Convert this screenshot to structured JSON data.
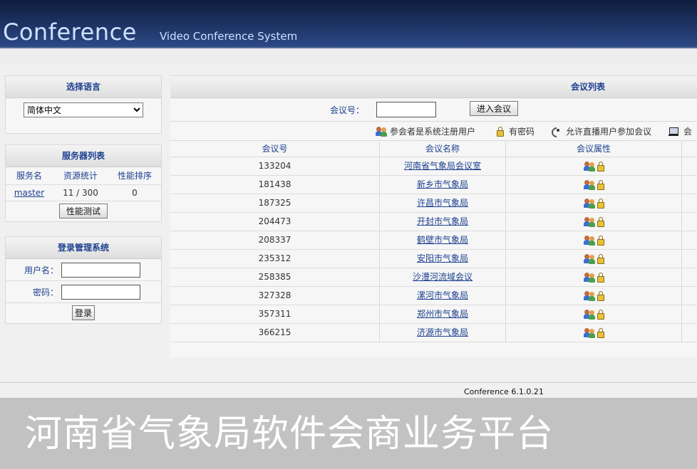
{
  "header": {
    "brand": "Conference",
    "subtitle": "Video Conference System"
  },
  "language_panel": {
    "title": "选择语言",
    "selected": "简体中文"
  },
  "server_panel": {
    "title": "服务器列表",
    "columns": [
      "服务名",
      "资源统计",
      "性能排序"
    ],
    "rows": [
      {
        "name": "master",
        "resources": "11 / 300",
        "rank": "0"
      }
    ],
    "test_button": "性能测试"
  },
  "login_panel": {
    "title": "登录管理系统",
    "username_label": "用户名：",
    "password_label": "密码：",
    "login_button": "登录"
  },
  "meeting_list": {
    "title": "会议列表",
    "join_label": "会议号：",
    "join_button": "进入会议",
    "legend": {
      "registered_users": "参会者是系统注册用户",
      "password": "有密码",
      "broadcast": "允许直播用户参加会议",
      "cut": "会"
    },
    "columns": [
      "会议号",
      "会议名称",
      "会议属性"
    ],
    "rows": [
      {
        "id": "133204",
        "name": "河南省气象局会议室"
      },
      {
        "id": "181438",
        "name": "新乡市气象局"
      },
      {
        "id": "187325",
        "name": "许昌市气象局"
      },
      {
        "id": "204473",
        "name": "开封市气象局"
      },
      {
        "id": "208337",
        "name": "鹤壁市气象局"
      },
      {
        "id": "235312",
        "name": "安阳市气象局"
      },
      {
        "id": "258385",
        "name": "沙澧河流域会议"
      },
      {
        "id": "327328",
        "name": "漯河市气象局"
      },
      {
        "id": "357311",
        "name": "郑州市气象局"
      },
      {
        "id": "366215",
        "name": "济源市气象局"
      }
    ]
  },
  "footer": {
    "version": "Conference 6.1.0.21"
  },
  "overlay": {
    "caption": "河南省气象局软件会商业务平台"
  },
  "icons": [
    "users-icon",
    "lock-icon",
    "broadcast-icon",
    "monitor-icon"
  ]
}
